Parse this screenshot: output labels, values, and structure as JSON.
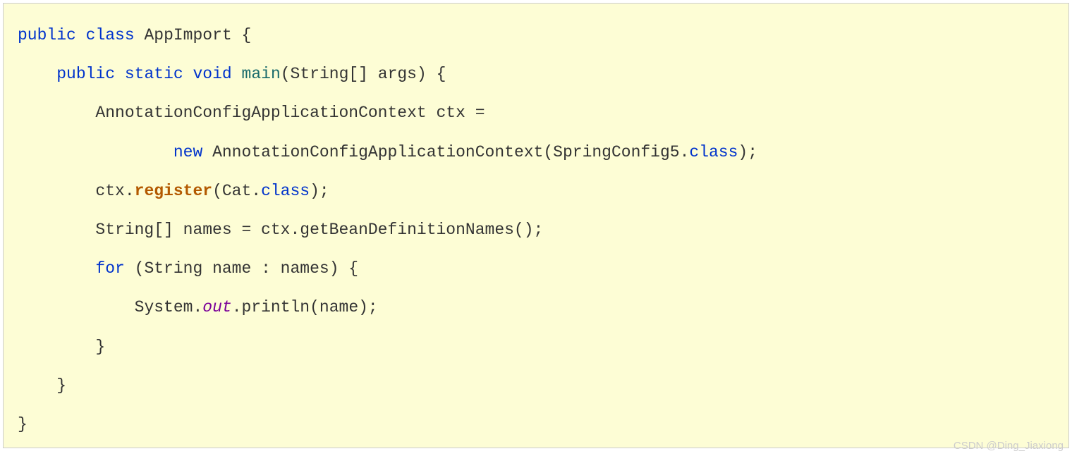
{
  "code": {
    "kw_public1": "public",
    "kw_class": "class",
    "classname": "AppImport",
    "brace_open1": "{",
    "kw_public2": "public",
    "kw_static": "static",
    "kw_void": "void",
    "method_main": "main",
    "main_params": "(String[] args) {",
    "line_ctx_decl": "AnnotationConfigApplicationContext ctx =",
    "kw_new": "new",
    "ctor_name": "AnnotationConfigApplicationContext(SpringConfig5.",
    "kw_class_ref1": "class",
    "paren_semi1": ");",
    "ctx_reg_pre": "ctx.",
    "method_register": "register",
    "reg_args_pre": "(Cat.",
    "kw_class_ref2": "class",
    "paren_semi2": ");",
    "line_names": "String[] names = ctx.getBeanDefinitionNames();",
    "kw_for": "for",
    "for_head": " (String name : names) {",
    "sys_pre": "System.",
    "field_out": "out",
    "sys_post": ".println(name);",
    "brace_close_for": "}",
    "brace_close_main": "}",
    "brace_close_class": "}"
  },
  "watermark": "CSDN @Ding_Jiaxiong"
}
